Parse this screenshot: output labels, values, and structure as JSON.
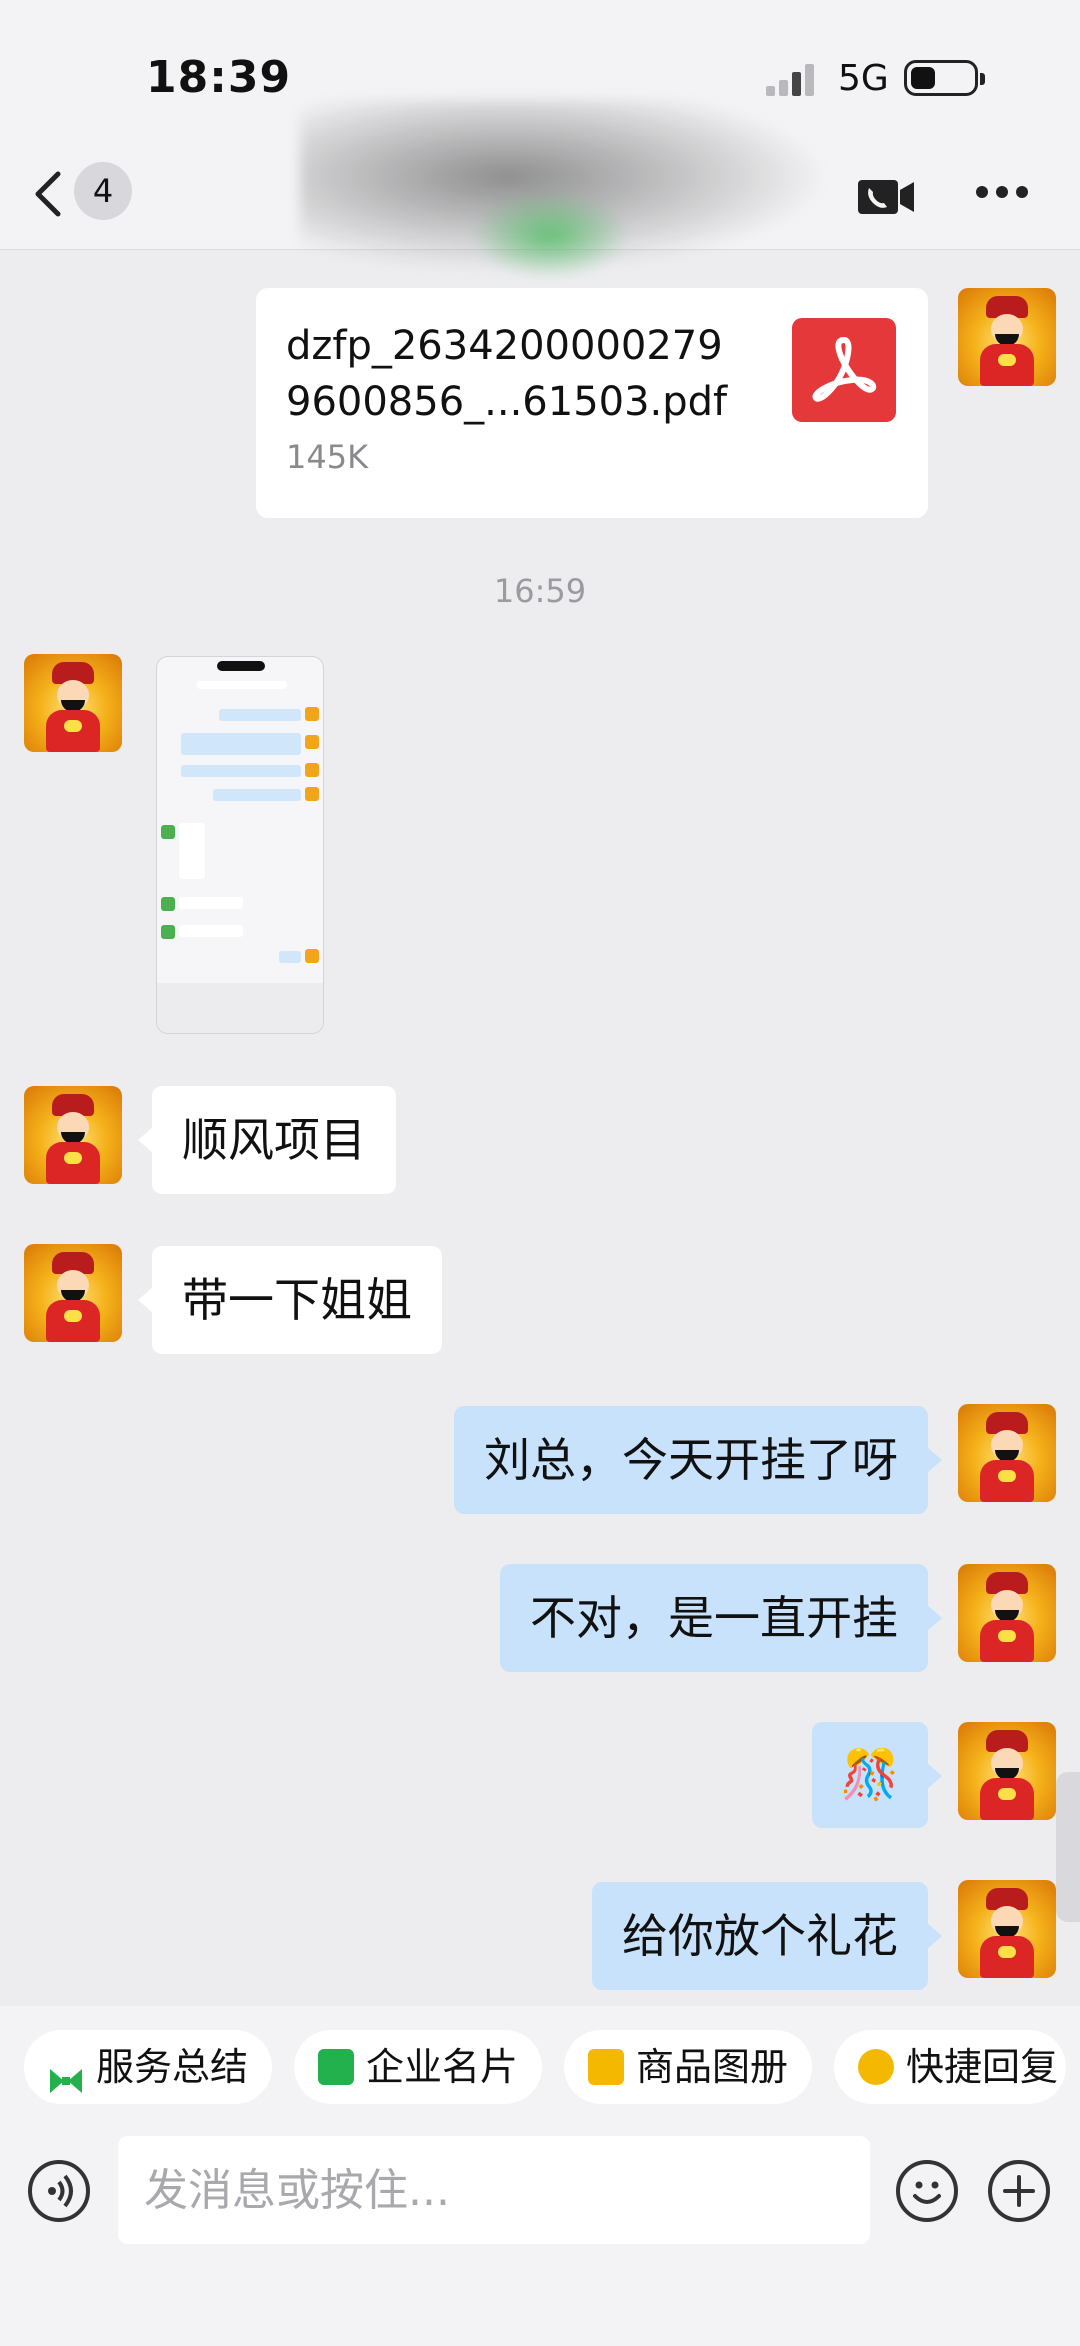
{
  "status_bar": {
    "time": "18:39",
    "network": "5G"
  },
  "header": {
    "unread_count": "4"
  },
  "messages": {
    "file": {
      "name_line1": "dzfp_2634200000279",
      "name_line2": "9600856_...61503.pdf",
      "size": "145K"
    },
    "timestamp": "16:59",
    "text1": "顺风项目",
    "text2": "带一下姐姐",
    "text3": "刘总，今天开挂了呀",
    "text4": "不对，是一直开挂",
    "emoji": "🎊",
    "text5": "给你放个礼花"
  },
  "quick_actions": [
    {
      "label": "服务总结",
      "icon": "bow-icon",
      "color": "#22b14c"
    },
    {
      "label": "企业名片",
      "icon": "card-icon",
      "color": "#22b14c"
    },
    {
      "label": "商品图册",
      "icon": "catalog-icon",
      "color": "#f5b800"
    },
    {
      "label": "快捷回复",
      "icon": "quick-reply-icon",
      "color": "#f5b800"
    }
  ],
  "input": {
    "placeholder": "发消息或按住..."
  }
}
